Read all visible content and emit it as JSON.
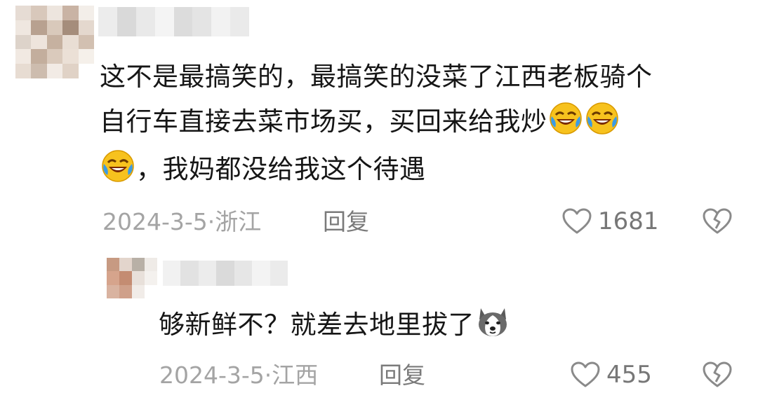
{
  "comments": [
    {
      "text_line1": "这不是最搞笑的，最搞笑的没菜了江西老板骑个",
      "text_line2": "自行车直接去菜市场买，买回来给我炒",
      "text_line3": "，我妈都没给我这个待遇",
      "emoji": "laughing-crying-emoji",
      "date": "2024-3-5",
      "separator": "·",
      "location": "浙江",
      "reply_label": "回复",
      "like_count": "1681"
    },
    {
      "text_main": "够新鲜不？就差去地里拔了",
      "emoji": "husky-dog-emoji",
      "date": "2024-3-5",
      "separator": "·",
      "location": "江西",
      "reply_label": "回复",
      "like_count": "455"
    }
  ],
  "icons": {
    "like": "heart-outline-icon",
    "dislike": "broken-heart-outline-icon"
  },
  "colors": {
    "meta_text": "#a4a4a4",
    "reply_text": "#7a7a7a",
    "icon_stroke": "#8a8a8a",
    "emoji_face": "#f7c21e",
    "emoji_tear": "#3a9be6"
  }
}
